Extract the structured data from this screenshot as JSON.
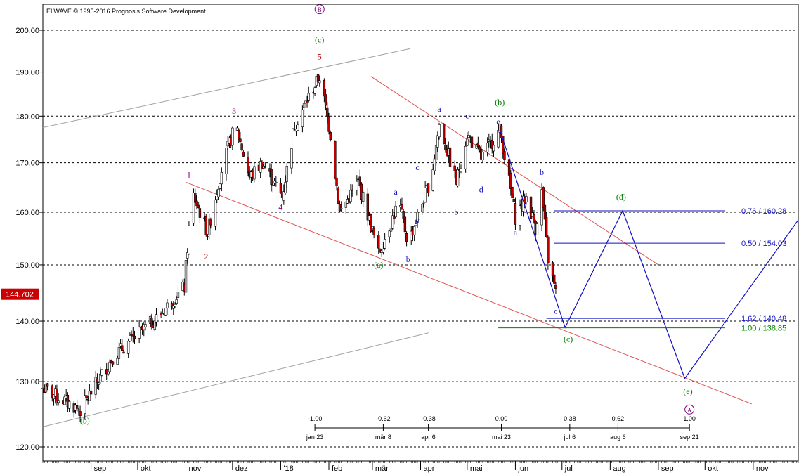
{
  "chart_data": {
    "type": "candlestick",
    "copyright": "ELWAVE © 1995-2016 Prognosis Software Development",
    "price_axis": {
      "scale": "log",
      "ylim": [
        118,
        205
      ],
      "ticks": [
        "120.00",
        "130.00",
        "140.00",
        "150.00",
        "160.00",
        "170.00",
        "180.00",
        "190.00",
        "200.00"
      ],
      "tick_values": [
        120,
        130,
        140,
        150,
        160,
        170,
        180,
        190,
        200
      ]
    },
    "current_price": {
      "label": "144.702",
      "value": 144.702,
      "color": "#cc0000"
    },
    "time_axis": {
      "start": "2017-08-01",
      "end": "2018-11-30",
      "months": [
        {
          "label": "sep",
          "date": "2017-09-01"
        },
        {
          "label": "okt",
          "date": "2017-10-01"
        },
        {
          "label": "nov",
          "date": "2017-11-01"
        },
        {
          "label": "dez",
          "date": "2017-12-01"
        },
        {
          "label": "'18",
          "date": "2018-01-01",
          "bold": true
        },
        {
          "label": "feb",
          "date": "2018-02-01"
        },
        {
          "label": "mär",
          "date": "2018-03-01"
        },
        {
          "label": "apr",
          "date": "2018-04-01"
        },
        {
          "label": "mai",
          "date": "2018-05-01"
        },
        {
          "label": "jun",
          "date": "2018-06-01"
        },
        {
          "label": "jul",
          "date": "2018-07-01"
        },
        {
          "label": "aug",
          "date": "2018-08-01"
        },
        {
          "label": "sep",
          "date": "2018-09-01"
        },
        {
          "label": "okt",
          "date": "2018-10-01"
        },
        {
          "label": "nov",
          "date": "2018-11-01"
        }
      ]
    },
    "anchors": [
      {
        "date": "2017-08-01",
        "price": 129
      },
      {
        "date": "2017-08-25",
        "price": 125.5
      },
      {
        "date": "2017-09-15",
        "price": 134
      },
      {
        "date": "2017-10-15",
        "price": 141
      },
      {
        "date": "2017-10-31",
        "price": 146
      },
      {
        "date": "2017-11-05",
        "price": 164
      },
      {
        "date": "2017-11-15",
        "price": 156
      },
      {
        "date": "2017-11-25",
        "price": 170
      },
      {
        "date": "2017-12-03",
        "price": 178
      },
      {
        "date": "2017-12-12",
        "price": 167
      },
      {
        "date": "2017-12-20",
        "price": 170
      },
      {
        "date": "2018-01-02",
        "price": 163
      },
      {
        "date": "2018-01-10",
        "price": 178
      },
      {
        "date": "2018-01-26",
        "price": 189
      },
      {
        "date": "2018-02-02",
        "price": 176
      },
      {
        "date": "2018-02-08",
        "price": 160
      },
      {
        "date": "2018-02-20",
        "price": 166
      },
      {
        "date": "2018-03-05",
        "price": 152
      },
      {
        "date": "2018-03-18",
        "price": 162
      },
      {
        "date": "2018-03-24",
        "price": 154
      },
      {
        "date": "2018-04-08",
        "price": 167
      },
      {
        "date": "2018-04-13",
        "price": 178
      },
      {
        "date": "2018-04-24",
        "price": 166
      },
      {
        "date": "2018-05-01",
        "price": 176
      },
      {
        "date": "2018-05-10",
        "price": 171
      },
      {
        "date": "2018-05-22",
        "price": 177
      },
      {
        "date": "2018-06-01",
        "price": 159
      },
      {
        "date": "2018-06-08",
        "price": 163
      },
      {
        "date": "2018-06-14",
        "price": 157
      },
      {
        "date": "2018-06-18",
        "price": 164
      },
      {
        "date": "2018-06-22",
        "price": 151
      },
      {
        "date": "2018-06-27",
        "price": 145
      }
    ],
    "wave_labels": [
      {
        "text": "B",
        "circled": true,
        "date": "2018-01-26",
        "price": 204.5,
        "color": "#800080"
      },
      {
        "text": "(c)",
        "date": "2018-01-26",
        "price": 197,
        "color": "#008000"
      },
      {
        "text": "5",
        "date": "2018-01-26",
        "price": 193,
        "color": "#aa0000"
      },
      {
        "text": "3",
        "date": "2017-12-02",
        "price": 180.5,
        "color": "#800080"
      },
      {
        "text": "1",
        "date": "2017-11-03",
        "price": 167,
        "color": "#800080"
      },
      {
        "text": "2",
        "date": "2017-11-14",
        "price": 151,
        "color": "#aa0000"
      },
      {
        "text": "4",
        "date": "2018-01-01",
        "price": 160.5,
        "color": "#800080"
      },
      {
        "text": "(b)",
        "date": "2017-08-28",
        "price": 123.5,
        "color": "#008000"
      },
      {
        "text": "(a)",
        "date": "2018-03-05",
        "price": 149.5,
        "color": "#008000"
      },
      {
        "text": "a",
        "date": "2018-03-16",
        "price": 163.5,
        "color": "#1010c0"
      },
      {
        "text": "b",
        "date": "2018-03-24",
        "price": 150.5,
        "color": "#1010c0"
      },
      {
        "text": "x",
        "date": "2018-03-30",
        "price": 157.8,
        "color": "#1010c0"
      },
      {
        "text": "c",
        "date": "2018-03-30",
        "price": 168.5,
        "color": "#1010c0"
      },
      {
        "text": "a",
        "date": "2018-04-13",
        "price": 181,
        "color": "#1010c0"
      },
      {
        "text": "b",
        "date": "2018-04-24",
        "price": 159.5,
        "color": "#1010c0"
      },
      {
        "text": "c",
        "date": "2018-05-01",
        "price": 179.5,
        "color": "#1010c0"
      },
      {
        "text": "d",
        "date": "2018-05-10",
        "price": 164,
        "color": "#1010c0"
      },
      {
        "text": "(b)",
        "date": "2018-05-22",
        "price": 182.5,
        "color": "#008000"
      },
      {
        "text": "e",
        "date": "2018-05-21",
        "price": 178.2,
        "color": "#1010c0"
      },
      {
        "text": "a",
        "date": "2018-06-01",
        "price": 155.5,
        "color": "#1010c0"
      },
      {
        "text": "b",
        "date": "2018-06-18",
        "price": 167.5,
        "color": "#1010c0"
      },
      {
        "text": "c",
        "date": "2018-06-27",
        "price": 141.3,
        "color": "#1010c0"
      },
      {
        "text": "(c)",
        "date": "2018-07-05",
        "price": 136.5,
        "color": "#008000"
      },
      {
        "text": "(d)",
        "date": "2018-08-08",
        "price": 162.5,
        "color": "#008000"
      },
      {
        "text": "(e)",
        "date": "2018-09-20",
        "price": 128,
        "color": "#008000"
      },
      {
        "text": "A",
        "circled": true,
        "date": "2018-09-21",
        "price": 125.2,
        "color": "#800080"
      }
    ],
    "channels": [
      {
        "from": {
          "date": "2017-08-01",
          "price": 177.5
        },
        "to": {
          "date": "2018-03-25",
          "price": 195.5
        },
        "color": "#a0a0a0"
      },
      {
        "from": {
          "date": "2017-08-01",
          "price": 123
        },
        "to": {
          "date": "2018-04-06",
          "price": 138
        },
        "color": "#a0a0a0"
      },
      {
        "from": {
          "date": "2017-11-01",
          "price": 166
        },
        "to": {
          "date": "2018-10-31",
          "price": 126.5
        },
        "color": "#e05050"
      },
      {
        "from": {
          "date": "2018-02-28",
          "price": 189
        },
        "to": {
          "date": "2018-09-01",
          "price": 150
        },
        "color": "#e05050"
      }
    ],
    "forecast_path": {
      "color": "#1010c0",
      "points": [
        {
          "date": "2018-05-22",
          "price": 177
        },
        {
          "date": "2018-07-03",
          "price": 138.9
        },
        {
          "date": "2018-08-09",
          "price": 160.3
        },
        {
          "date": "2018-09-18",
          "price": 130.5
        },
        {
          "date": "2018-11-30",
          "price": 158.5
        }
      ]
    },
    "fib_levels": [
      {
        "label": "0.76 / 160.28",
        "price": 160.28,
        "from": "2018-06-26",
        "to": "2018-10-14",
        "color": "#1010c0"
      },
      {
        "label": "0.50 / 154.03",
        "price": 154.03,
        "from": "2018-06-26",
        "to": "2018-10-14",
        "color": "#1010c0"
      },
      {
        "label": "1.62 / 140.48",
        "price": 140.48,
        "from": "2018-06-21",
        "to": "2018-10-14",
        "color": "#1010c0"
      },
      {
        "label": "1.00 / 138.85",
        "price": 138.85,
        "from": "2018-05-21",
        "to": "2018-10-14",
        "color": "#008000"
      }
    ],
    "time_ruler": {
      "ticks": [
        {
          "ratio": "-1.00",
          "label": "jan 23",
          "date": "2018-01-23"
        },
        {
          "ratio": "-0.62",
          "label": "mär 8",
          "date": "2018-03-08"
        },
        {
          "ratio": "-0.38",
          "label": "apr 6",
          "date": "2018-04-06"
        },
        {
          "ratio": "0.00",
          "label": "mai 23",
          "date": "2018-05-23"
        },
        {
          "ratio": "0.38",
          "label": "jul 6",
          "date": "2018-07-06"
        },
        {
          "ratio": "0.62",
          "label": "aug 6",
          "date": "2018-08-06"
        },
        {
          "ratio": "1.00",
          "label": "sep 21",
          "date": "2018-09-21"
        }
      ]
    }
  }
}
